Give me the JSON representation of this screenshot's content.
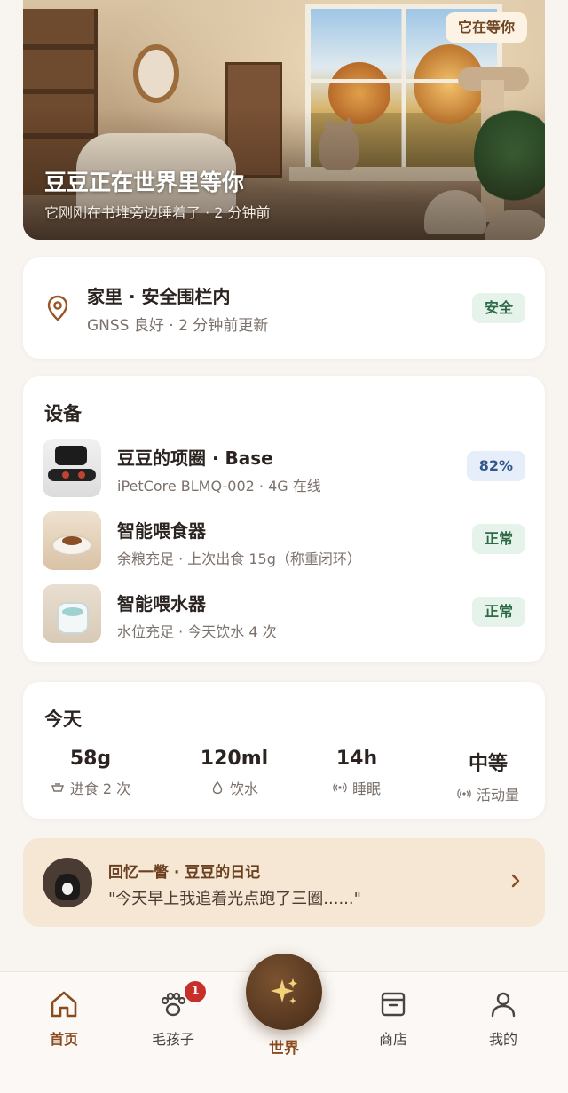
{
  "hero": {
    "badge": "它在等你",
    "title": "豆豆正在世界里等你",
    "subtitle": "它刚刚在书堆旁边睡着了 · 2 分钟前"
  },
  "location": {
    "title": "家里 · 安全围栏内",
    "subtitle": "GNSS 良好 · 2 分钟前更新",
    "status": "安全",
    "icon": "location-pin-icon"
  },
  "devices": {
    "title": "设备",
    "items": [
      {
        "name": "豆豆的项圈 · Base",
        "meta": "iPetCore BLMQ-002 · 4G 在线",
        "status": "82%",
        "status_kind": "battery"
      },
      {
        "name": "智能喂食器",
        "meta": "余粮充足 · 上次出食 15g（称重闭环）",
        "status": "正常",
        "status_kind": "ok"
      },
      {
        "name": "智能喂水器",
        "meta": "水位充足 · 今天饮水 4 次",
        "status": "正常",
        "status_kind": "ok"
      }
    ]
  },
  "today": {
    "title": "今天",
    "stats": [
      {
        "value": "58g",
        "label": "进食 2 次",
        "icon": "bowl-icon"
      },
      {
        "value": "120ml",
        "label": "饮水",
        "icon": "water-drop-icon"
      },
      {
        "value": "14h",
        "label": "睡眠",
        "icon": "signal-icon"
      },
      {
        "value": "中等",
        "label": "活动量",
        "icon": "signal-icon"
      }
    ]
  },
  "diary": {
    "title": "回忆一瞥 · 豆豆的日记",
    "quote": "\"今天早上我追着光点跑了三圈......\""
  },
  "tabbar": {
    "home": "首页",
    "pets": "毛孩子",
    "pets_badge": "1",
    "world": "世界",
    "shop": "商店",
    "me": "我的"
  },
  "colors": {
    "accent": "#8a4a1c",
    "safe_bg": "#e5f3ea",
    "safe_text": "#2d6a46",
    "battery_bg": "#e6eefa",
    "battery_text": "#33578a",
    "diary_bg": "#f6e7d4",
    "badge_red": "#c72f2a"
  }
}
